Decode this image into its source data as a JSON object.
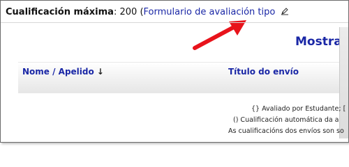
{
  "grade": {
    "label": "Cualificación máxima",
    "separator": ":",
    "value": "200",
    "paren_open": "(",
    "form_link": "Formulario de avaliación tipo",
    "edit_icon": "edit-pencil-icon"
  },
  "annotation": {
    "arrow_color": "#e8131b"
  },
  "main": {
    "show_title": "Mostrar a"
  },
  "table": {
    "columns": [
      {
        "label": "Nome / Apelido",
        "sort_indicator": "↓"
      },
      {
        "label": "Título do envío"
      }
    ]
  },
  "legend": {
    "line1": "{} Avaliado por Estudante;   [",
    "line2": "() Cualificación automática da a",
    "line3": "As cualificacións dos envíos son so"
  },
  "colors": {
    "link": "#1a27a6",
    "text": "#111111",
    "header_gradient_bottom": "#e6e6e6"
  }
}
